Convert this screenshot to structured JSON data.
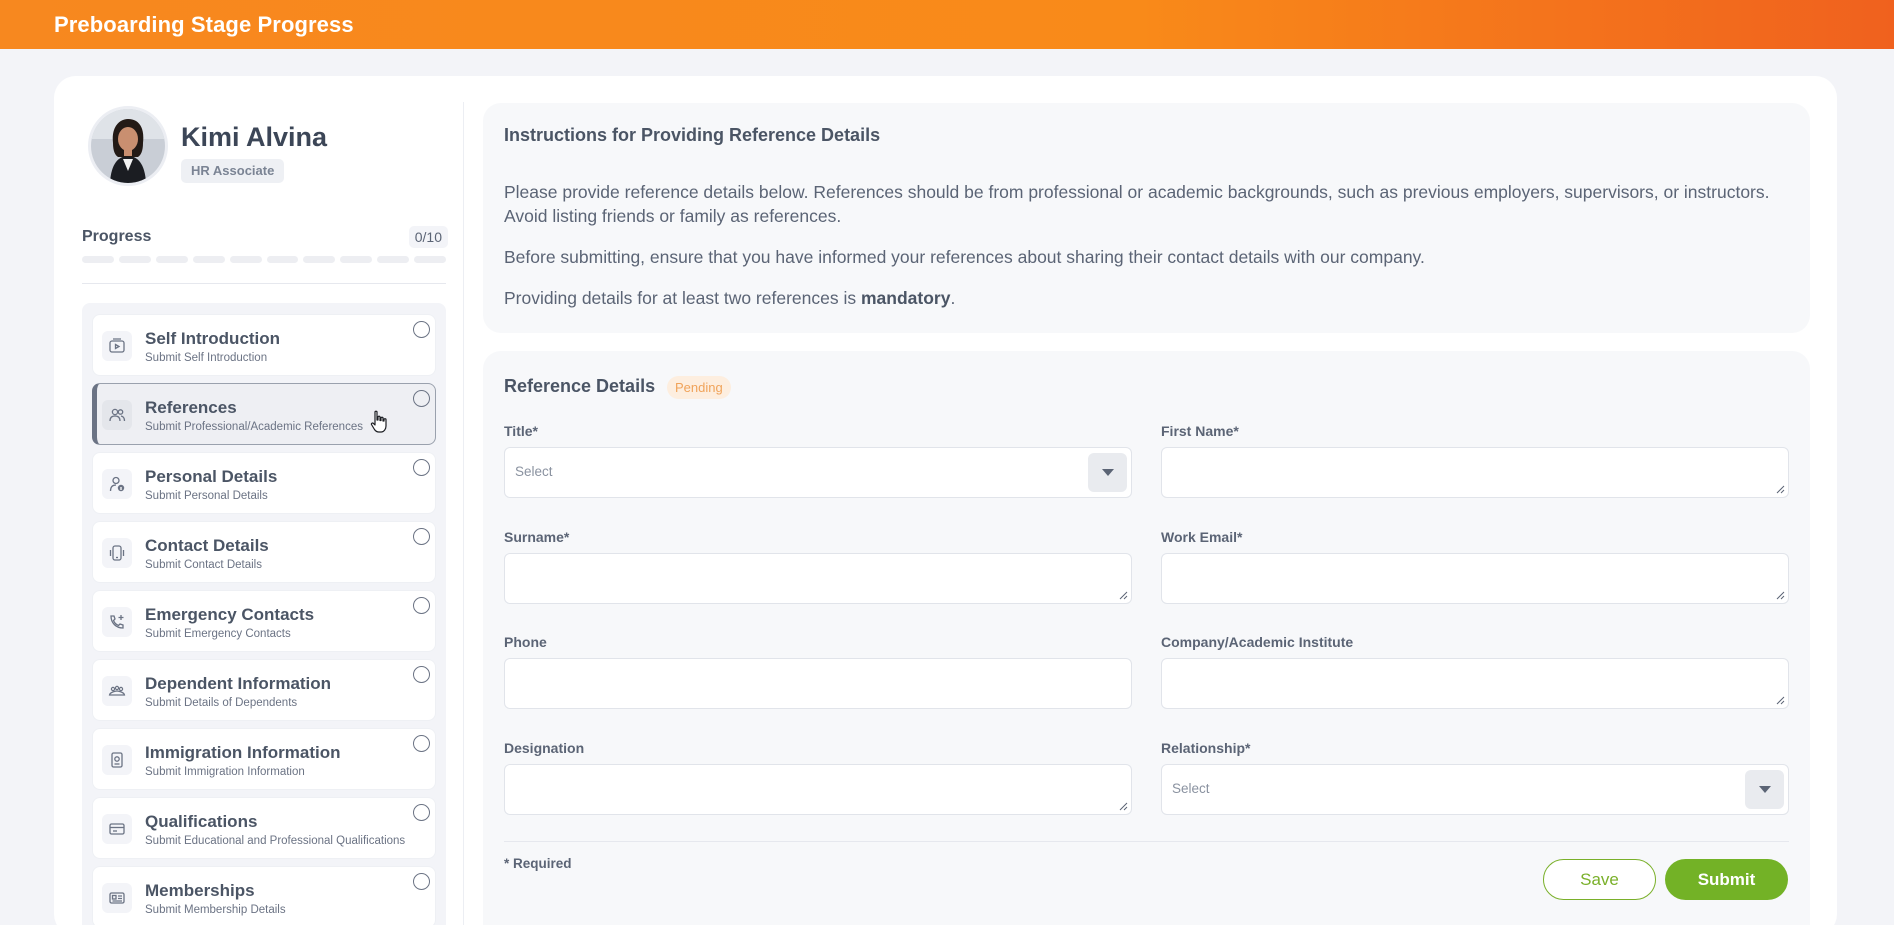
{
  "header": {
    "title": "Preboarding Stage Progress"
  },
  "profile": {
    "name": "Kimi Alvina",
    "role": "HR Associate"
  },
  "progress": {
    "label": "Progress",
    "count": "0/10",
    "completed_fraction": 0
  },
  "steps": [
    {
      "title": "Self Introduction",
      "subtitle": "Submit Self Introduction",
      "icon": "video-icon",
      "active": false
    },
    {
      "title": "References",
      "subtitle": "Submit Professional/Academic References",
      "icon": "users-icon",
      "active": true
    },
    {
      "title": "Personal Details",
      "subtitle": "Submit Personal Details",
      "icon": "user-info-icon",
      "active": false
    },
    {
      "title": "Contact Details",
      "subtitle": "Submit Contact Details",
      "icon": "mobile-icon",
      "active": false
    },
    {
      "title": "Emergency Contacts",
      "subtitle": "Submit Emergency Contacts",
      "icon": "phone-plus-icon",
      "active": false
    },
    {
      "title": "Dependent Information",
      "subtitle": "Submit Details of Dependents",
      "icon": "family-icon",
      "active": false
    },
    {
      "title": "Immigration Information",
      "subtitle": "Submit Immigration Information",
      "icon": "passport-icon",
      "active": false
    },
    {
      "title": "Qualifications",
      "subtitle": "Submit Educational and Professional Qualifications",
      "icon": "certificate-icon",
      "active": false
    },
    {
      "title": "Memberships",
      "subtitle": "Submit Membership Details",
      "icon": "membership-card-icon",
      "active": false
    }
  ],
  "instructions": {
    "title": "Instructions for Providing Reference Details",
    "p1": "Please provide reference details below. References should be from professional or academic backgrounds, such as previous employers, supervisors, or instructors. Avoid listing friends or family as references.",
    "p2": "Before submitting, ensure that you have informed your references about sharing their contact details with our company.",
    "p3_before": "Providing details for at least two references is ",
    "p3_bold": "mandatory",
    "p3_after": "."
  },
  "form": {
    "title": "Reference Details",
    "status": "Pending",
    "fields": {
      "title": {
        "label": "Title*",
        "placeholder": "Select",
        "value": ""
      },
      "first_name": {
        "label": "First Name*",
        "value": ""
      },
      "surname": {
        "label": "Surname*",
        "value": ""
      },
      "work_email": {
        "label": "Work Email*",
        "value": ""
      },
      "phone": {
        "label": "Phone",
        "value": ""
      },
      "company": {
        "label": "Company/Academic Institute",
        "value": ""
      },
      "designation": {
        "label": "Designation",
        "value": ""
      },
      "relationship": {
        "label": "Relationship*",
        "placeholder": "Select",
        "value": ""
      }
    },
    "required_note": "* Required",
    "save_label": "Save",
    "submit_label": "Submit"
  },
  "colors": {
    "header_start": "#f7881f",
    "header_end": "#f0611e",
    "accent_green": "#73b226",
    "pending_bg": "#fdeedf",
    "pending_text": "#f0a35a"
  }
}
